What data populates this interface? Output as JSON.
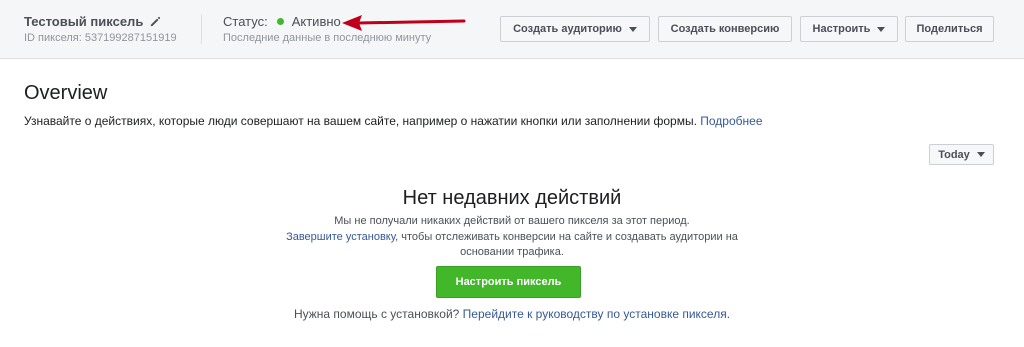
{
  "header": {
    "pixel_name": "Тестовый пиксель",
    "pixel_id": "ID пикселя: 537199287151919",
    "status_label": "Статус:",
    "status_value": "Активно",
    "status_sub": "Последние данные в последнюю минуту",
    "buttons": {
      "create_audience": "Создать аудиторию",
      "create_conversion": "Создать конверсию",
      "configure": "Настроить",
      "share": "Поделиться"
    },
    "colors": {
      "status_active": "#42b72a",
      "arrow": "#c0001a"
    }
  },
  "overview": {
    "title": "Overview",
    "description": "Узнавайте о действиях, которые люди совершают на вашем сайте, например о нажатии кнопки или заполнении формы.",
    "more_link": "Подробнее",
    "date_range": "Today"
  },
  "empty_state": {
    "title": "Нет недавних действий",
    "line1": "Мы не получали никаких действий от вашего пикселя за этот период.",
    "line2_link": "Завершите установку",
    "line2_rest": ", чтобы отслеживать конверсии на сайте и создавать аудитории на",
    "line3": "основании трафика.",
    "setup_button": "Настроить пиксель",
    "help_text": "Нужна помощь с установкой?",
    "help_link": "Перейдите к руководству по установке пикселя."
  },
  "icons": [
    "pencil-icon",
    "status-dot-icon",
    "red-arrow-annotation",
    "caret-down-icon"
  ]
}
